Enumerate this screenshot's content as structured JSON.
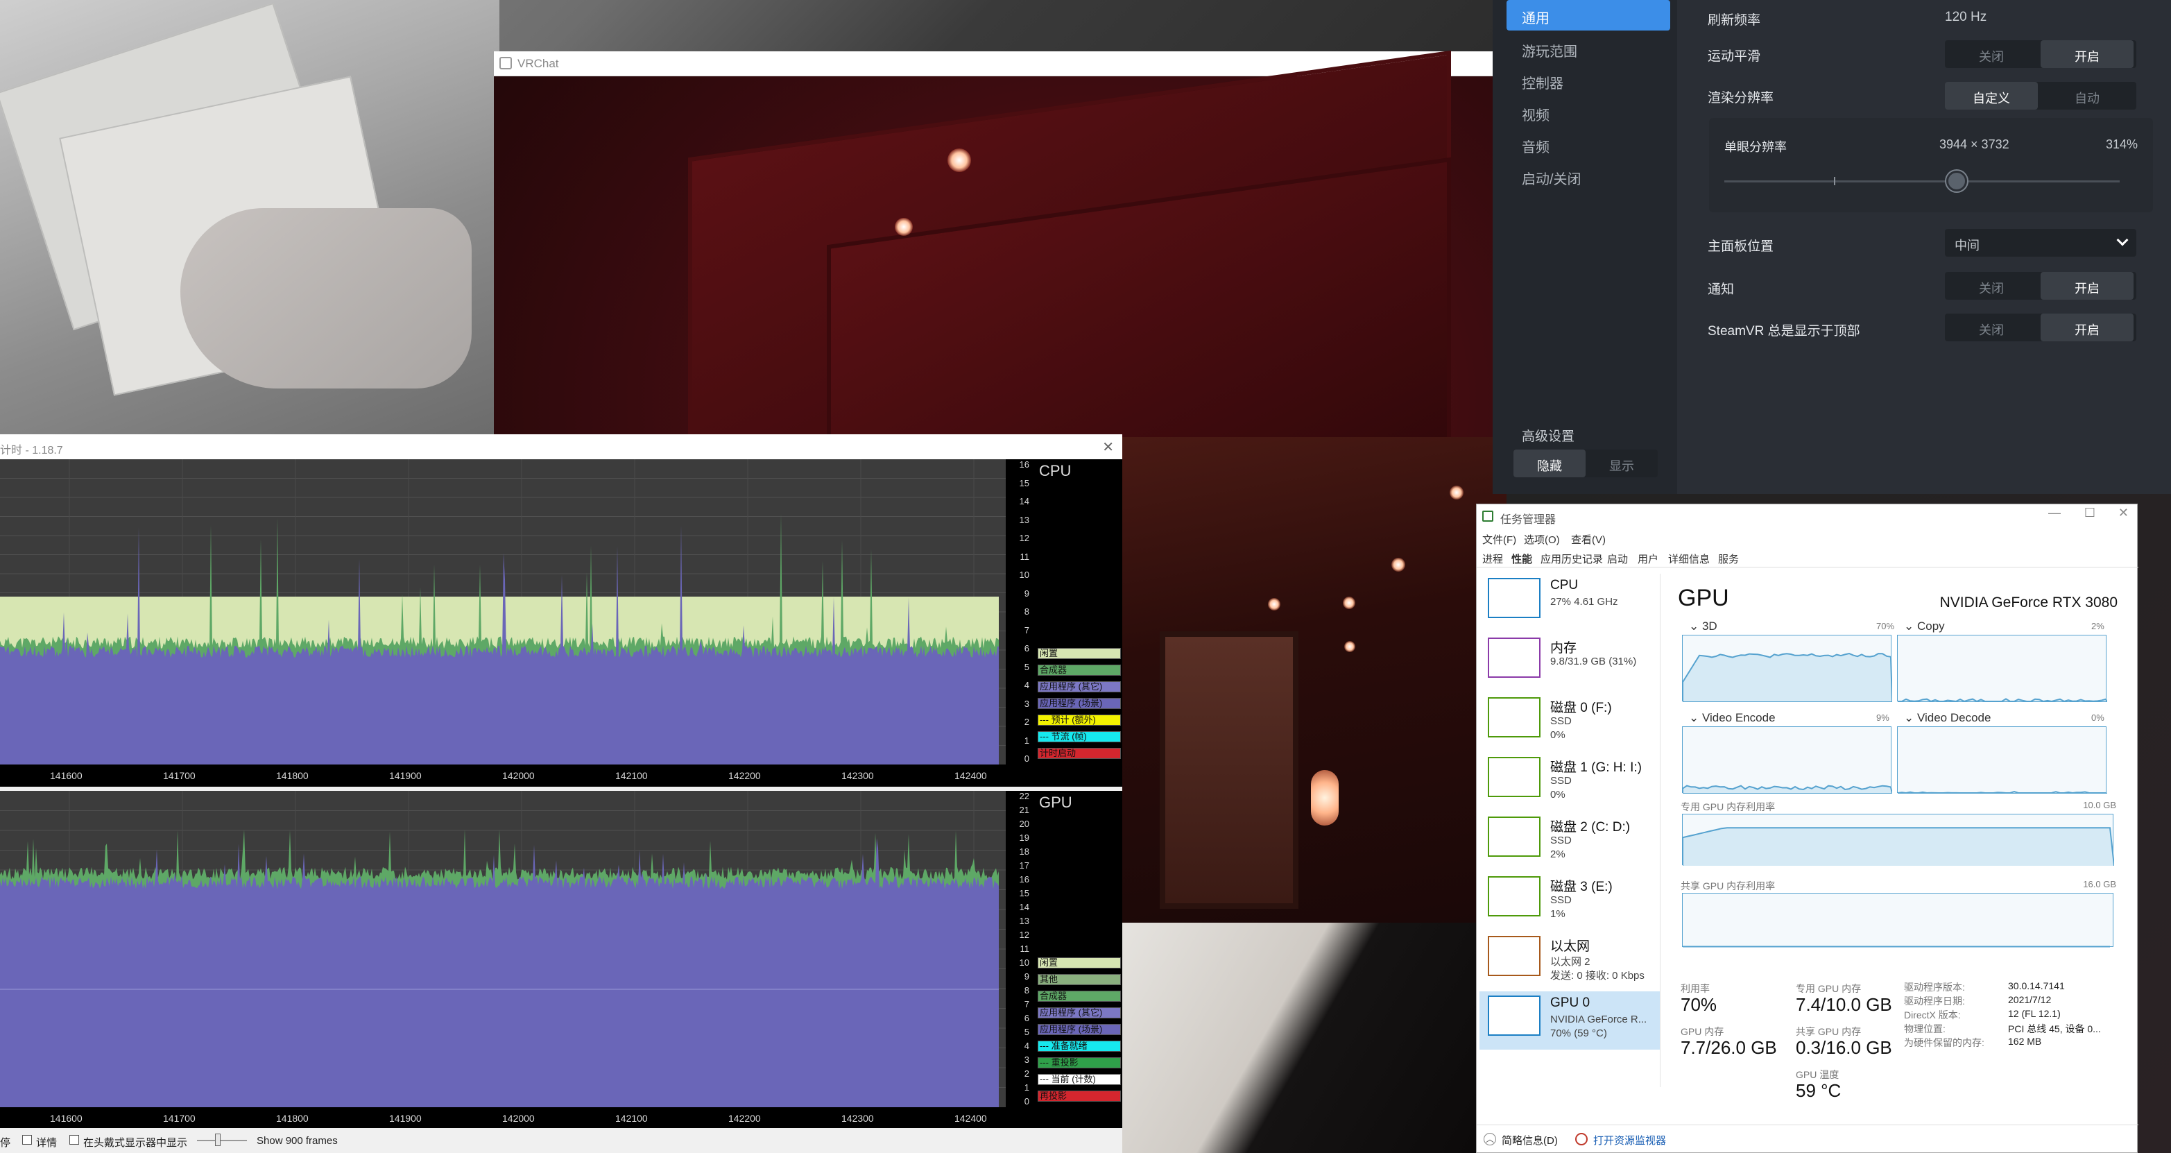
{
  "vrchat": {
    "title": "VRChat"
  },
  "steamvr": {
    "sidebar": [
      "通用",
      "游玩范围",
      "控制器",
      "视频",
      "音频",
      "启动/关闭"
    ],
    "advanced": {
      "label": "高级设置",
      "hide": "隐藏",
      "show": "显示"
    },
    "refresh": {
      "label": "刷新频率",
      "value": "120 Hz"
    },
    "motion_smoothing": {
      "label": "运动平滑",
      "off": "关闭",
      "on": "开启"
    },
    "render_resolution": {
      "label": "渲染分辨率",
      "custom": "自定义",
      "auto": "自动"
    },
    "per_eye": {
      "label": "单眼分辨率",
      "value": "3944 × 3732",
      "percent": "314%"
    },
    "dashboard_position": {
      "label": "主面板位置",
      "value": "中间"
    },
    "notifications": {
      "label": "通知",
      "off": "关闭",
      "on": "开启"
    },
    "always_on_top": {
      "label": "SteamVR 总是显示于顶部",
      "off": "关闭",
      "on": "开启"
    }
  },
  "frame_timing": {
    "title": "计时 - 1.18.7",
    "cpu_label": "CPU",
    "gpu_label": "GPU",
    "cpu_ticks": [
      "16",
      "15",
      "14",
      "13",
      "12",
      "11",
      "10",
      "9",
      "8",
      "7",
      "6",
      "5",
      "4",
      "3",
      "2",
      "1",
      "0"
    ],
    "gpu_ticks": [
      "22",
      "21",
      "20",
      "19",
      "18",
      "17",
      "16",
      "15",
      "14",
      "13",
      "12",
      "11",
      "10",
      "9",
      "8",
      "7",
      "6",
      "5",
      "4",
      "3",
      "2",
      "1",
      "0"
    ],
    "x_ticks": [
      "141600",
      "141700",
      "141800",
      "141900",
      "142000",
      "142100",
      "142200",
      "142300",
      "142400"
    ],
    "cpu_legend": [
      {
        "text": "闲置",
        "color": "#d7e6b2"
      },
      {
        "text": "合成器",
        "color": "#5ea866"
      },
      {
        "text": "应用程序 (其它)",
        "color": "#7c78c4"
      },
      {
        "text": "应用程序 (场景)",
        "color": "#6a66b8"
      },
      {
        "text": "--- 预计 (额外)",
        "color": "#f2f200"
      },
      {
        "text": "--- 节流 (帧)",
        "color": "#16e8ee"
      },
      {
        "text": "计时启动",
        "color": "#d4262e"
      }
    ],
    "gpu_legend": [
      {
        "text": "闲置",
        "color": "#d7e6b2"
      },
      {
        "text": "其他",
        "color": "#8ab07e"
      },
      {
        "text": "合成器",
        "color": "#5ea866"
      },
      {
        "text": "应用程序 (其它)",
        "color": "#7c78c4"
      },
      {
        "text": "应用程序 (场景)",
        "color": "#6a66b8"
      },
      {
        "text": "--- 准备就绪",
        "color": "#16e8ee"
      },
      {
        "text": "--- 重投影",
        "color": "#2fa14a"
      },
      {
        "text": "--- 当前 (计数)",
        "color": "#ffffff"
      },
      {
        "text": "再投影",
        "color": "#d4262e"
      }
    ],
    "footer": {
      "pause": "停",
      "details": "详情",
      "show_in_headset": "在头戴式显示器中显示",
      "frames": "Show 900 frames"
    }
  },
  "task_manager": {
    "title": "任务管理器",
    "menu": [
      "文件(F)",
      "选项(O)",
      "查看(V)"
    ],
    "tabs": [
      "进程",
      "性能",
      "应用历史记录",
      "启动",
      "用户",
      "详细信息",
      "服务"
    ],
    "resources": [
      {
        "name": "CPU",
        "sub1": "27% 4.61 GHz",
        "sub2": "",
        "sub3": "",
        "color": "#1b7fc4"
      },
      {
        "name": "内存",
        "sub1": "9.8/31.9 GB (31%)",
        "sub2": "",
        "sub3": "",
        "color": "#8b3aa9"
      },
      {
        "name": "磁盘 0 (F:)",
        "sub1": "SSD",
        "sub2": "0%",
        "sub3": "",
        "color": "#4e9a0a"
      },
      {
        "name": "磁盘 1 (G: H: I:)",
        "sub1": "SSD",
        "sub2": "0%",
        "sub3": "",
        "color": "#4e9a0a"
      },
      {
        "name": "磁盘 2 (C: D:)",
        "sub1": "SSD",
        "sub2": "2%",
        "sub3": "",
        "color": "#4e9a0a"
      },
      {
        "name": "磁盘 3 (E:)",
        "sub1": "SSD",
        "sub2": "1%",
        "sub3": "",
        "color": "#4e9a0a"
      },
      {
        "name": "以太网",
        "sub1": "以太网 2",
        "sub2": "发送: 0 接收: 0 Kbps",
        "sub3": "",
        "color": "#a7591b"
      },
      {
        "name": "GPU 0",
        "sub1": "NVIDIA GeForce R...",
        "sub2": "70% (59 °C)",
        "sub3": "",
        "color": "#1b7fc4"
      }
    ],
    "gpu": {
      "heading": "GPU",
      "model": "NVIDIA GeForce RTX 3080",
      "engines": [
        {
          "name": "3D",
          "pct": "70%"
        },
        {
          "name": "Copy",
          "pct": "2%"
        },
        {
          "name": "Video Encode",
          "pct": "9%"
        },
        {
          "name": "Video Decode",
          "pct": "0%"
        }
      ],
      "dedicated": {
        "label": "专用 GPU 内存利用率",
        "max": "10.0 GB"
      },
      "shared": {
        "label": "共享 GPU 内存利用率",
        "max": "16.0 GB"
      },
      "stats": [
        {
          "label": "利用率",
          "value": "70%"
        },
        {
          "label": "专用 GPU 内存",
          "value": "7.4/10.0 GB"
        },
        {
          "label": "GPU 内存",
          "value": "7.7/26.0 GB"
        },
        {
          "label": "共享 GPU 内存",
          "value": "0.3/16.0 GB"
        },
        {
          "label": "GPU 温度",
          "value": "59 °C"
        }
      ],
      "info": [
        {
          "k": "驱动程序版本:",
          "v": "30.0.14.7141"
        },
        {
          "k": "驱动程序日期:",
          "v": "2021/7/12"
        },
        {
          "k": "DirectX 版本:",
          "v": "12 (FL 12.1)"
        },
        {
          "k": "物理位置:",
          "v": "PCI 总线 45, 设备 0..."
        },
        {
          "k": "为硬件保留的内存:",
          "v": "162 MB"
        }
      ]
    },
    "footer": {
      "brief": "简略信息(D)",
      "monitor": "打开资源监视器"
    }
  },
  "colors": {
    "accent_blue": "#3c8ee8",
    "cpu_fill": "#6a66b8",
    "idle_fill": "#d7e6b2",
    "tm_line": "#55a2cf"
  }
}
